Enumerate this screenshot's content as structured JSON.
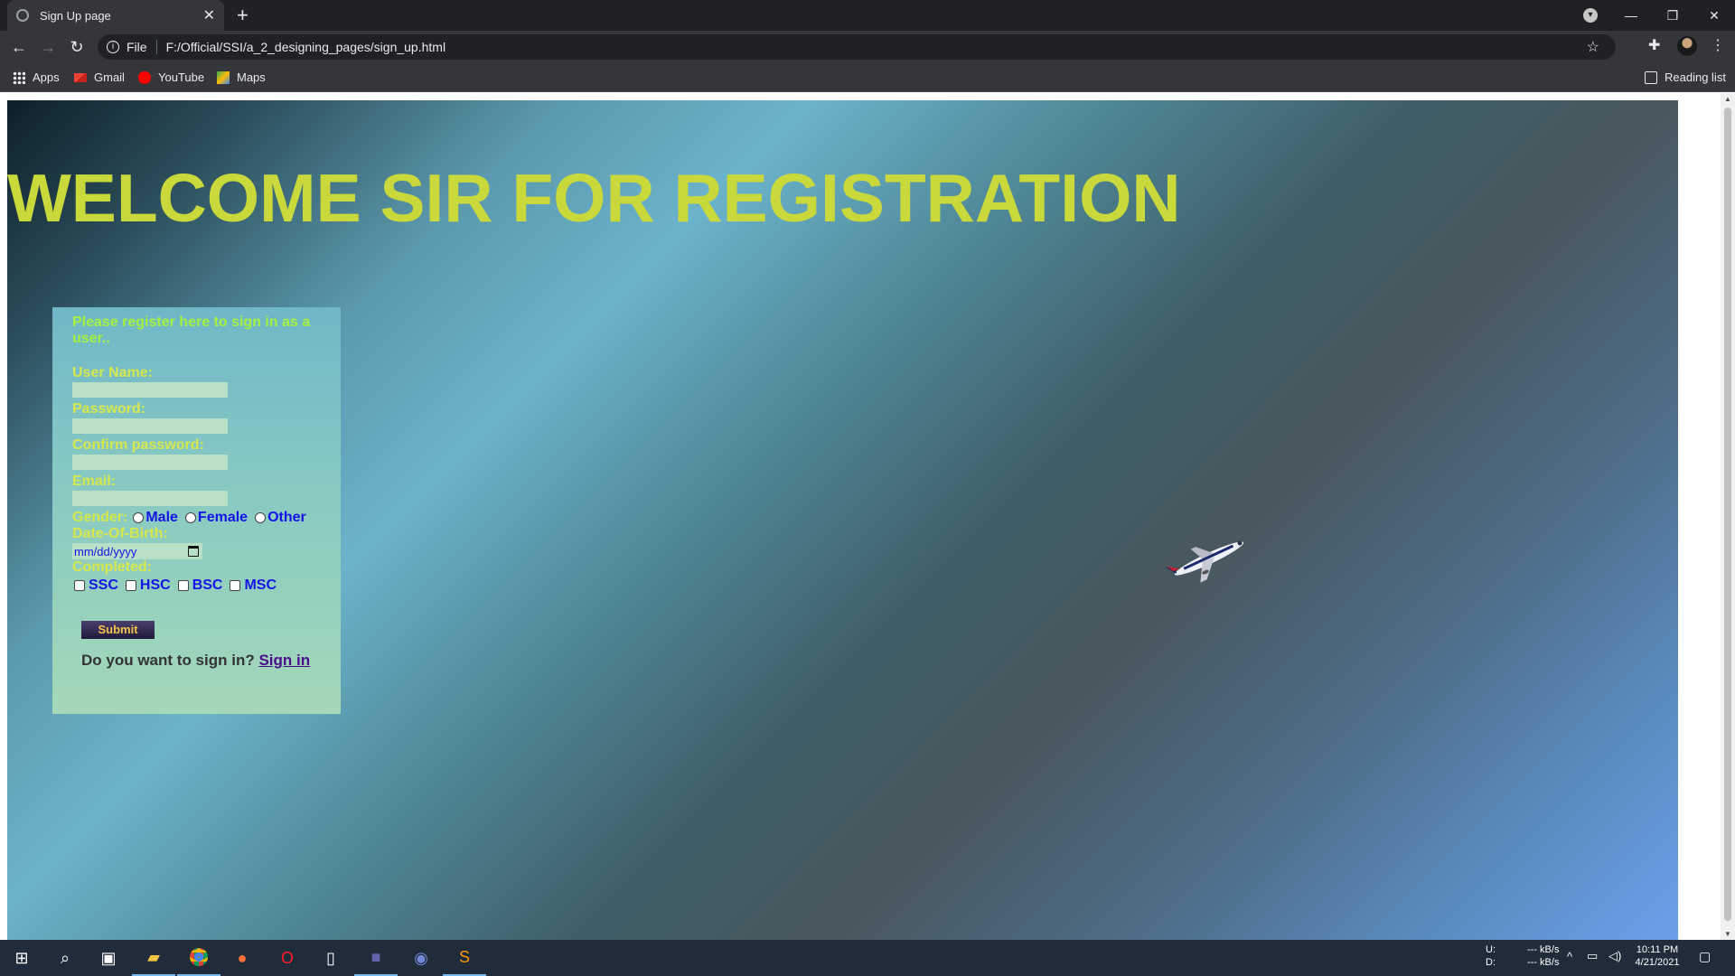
{
  "browser": {
    "tab_title": "Sign Up page",
    "url_scheme_label": "File",
    "url": "F:/Official/SSI/a_2_designing_pages/sign_up.html",
    "bookmarks": [
      "Apps",
      "Gmail",
      "YouTube",
      "Maps"
    ],
    "reading_list": "Reading list"
  },
  "page": {
    "heading": "WELCOME SIR FOR REGISTRATION",
    "form": {
      "intro": "Please register here to sign in as a user..",
      "username_label": "User Name:",
      "password_label": "Password:",
      "confirm_label": "Confirm password:",
      "email_label": "Email:",
      "gender_label": "Gender:",
      "gender_options": [
        "Male",
        "Female",
        "Other"
      ],
      "dob_label": "Date-Of-Birth:",
      "dob_placeholder": "mm/dd/yyyy",
      "completed_label": "Completed:",
      "completed_options": [
        "SSC",
        "HSC",
        "BSC",
        "MSC"
      ],
      "submit_label": "Submit",
      "signin_question": "Do you want to sign in?",
      "signin_link": "Sign in"
    }
  },
  "taskbar": {
    "net_up": "U:",
    "net_down": "D:",
    "net_up_rate": "--- kB/s",
    "net_down_rate": "--- kB/s",
    "time": "10:11 PM",
    "date": "4/21/2021"
  },
  "colors": {
    "heading": "#c9d93c",
    "labels": "#d7e84c",
    "intro": "#a6f040",
    "options": "#1414e6"
  }
}
